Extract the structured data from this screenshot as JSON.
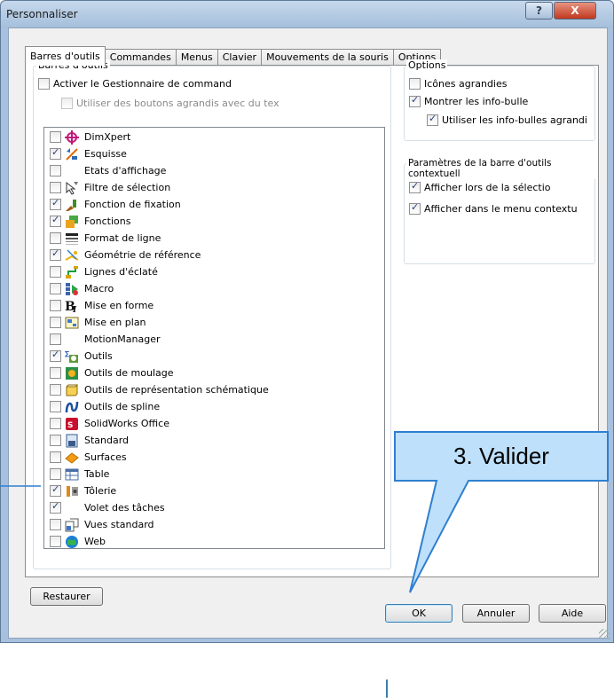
{
  "window": {
    "title": "Personnaliser",
    "help_glyph": "?",
    "close_glyph": "X"
  },
  "tabs": [
    "Barres d'outils",
    "Commandes",
    "Menus",
    "Clavier",
    "Mouvements de la souris",
    "Options"
  ],
  "toolbars_group": {
    "title": "Barres d'outils",
    "enable_manager": {
      "label": "Activer le Gestionnaire de command",
      "checked": false
    },
    "large_buttons": {
      "label": "Utiliser des boutons agrandis avec du tex",
      "checked": false,
      "disabled": true
    }
  },
  "toolbar_list": [
    {
      "label": "DimXpert",
      "checked": false,
      "icon": "dimxpert-icon"
    },
    {
      "label": "Esquisse",
      "checked": true,
      "icon": "sketch-icon"
    },
    {
      "label": "Etats d'affichage",
      "checked": false,
      "icon": ""
    },
    {
      "label": "Filtre de sélection",
      "checked": false,
      "icon": "selection-filter-icon"
    },
    {
      "label": "Fonction de fixation",
      "checked": true,
      "icon": "fastening-icon"
    },
    {
      "label": "Fonctions",
      "checked": true,
      "icon": "features-icon"
    },
    {
      "label": "Format de ligne",
      "checked": false,
      "icon": "line-format-icon"
    },
    {
      "label": "Géométrie de référence",
      "checked": true,
      "icon": "reference-geometry-icon"
    },
    {
      "label": "Lignes d'éclaté",
      "checked": false,
      "icon": "explode-lines-icon"
    },
    {
      "label": "Macro",
      "checked": false,
      "icon": "macro-icon"
    },
    {
      "label": "Mise en forme",
      "checked": false,
      "icon": "formatting-icon"
    },
    {
      "label": "Mise en plan",
      "checked": false,
      "icon": "drawing-icon"
    },
    {
      "label": "MotionManager",
      "checked": false,
      "icon": ""
    },
    {
      "label": "Outils",
      "checked": true,
      "icon": "tools-icon"
    },
    {
      "label": "Outils de moulage",
      "checked": false,
      "icon": "mold-tools-icon"
    },
    {
      "label": "Outils de représentation schématique",
      "checked": false,
      "icon": "schematic-icon"
    },
    {
      "label": "Outils de spline",
      "checked": false,
      "icon": "spline-tools-icon"
    },
    {
      "label": "SolidWorks Office",
      "checked": false,
      "icon": "solidworks-office-icon"
    },
    {
      "label": "Standard",
      "checked": false,
      "icon": "standard-icon"
    },
    {
      "label": "Surfaces",
      "checked": false,
      "icon": "surfaces-icon"
    },
    {
      "label": "Table",
      "checked": false,
      "icon": "table-icon"
    },
    {
      "label": "Tôlerie",
      "checked": true,
      "icon": "sheet-metal-icon"
    },
    {
      "label": "Volet des tâches",
      "checked": true,
      "icon": ""
    },
    {
      "label": "Vues standard",
      "checked": false,
      "icon": "standard-views-icon"
    },
    {
      "label": "Web",
      "checked": false,
      "icon": "web-icon"
    }
  ],
  "options_group": {
    "title": "Options",
    "large_icons": {
      "label": "Icônes agrandies",
      "checked": false
    },
    "show_tooltips": {
      "label": "Montrer les info-bulle",
      "checked": true
    },
    "large_tooltips": {
      "label": "Utiliser les info-bulles agrandi",
      "checked": true
    }
  },
  "context_group": {
    "title": "Paramètres de la barre d'outils contextuell",
    "on_selection": {
      "label": "Afficher lors de la sélectio",
      "checked": true
    },
    "in_context_menu": {
      "label": "Afficher dans le menu contextu",
      "checked": true
    }
  },
  "buttons": {
    "restore": "Restaurer",
    "ok": "OK",
    "cancel": "Annuler",
    "help": "Aide"
  },
  "callout": {
    "text": "3. Valider",
    "fill": "#bfe0fb",
    "border": "#2f7fd0"
  },
  "colors": {
    "window_frame": "#a7c0dd",
    "dialog_bg": "#f0f0f0",
    "close_red": "#c0391f"
  }
}
